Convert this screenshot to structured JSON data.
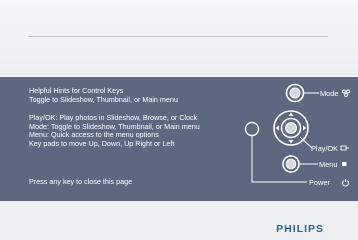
{
  "hints": {
    "block1": [
      "Helpful Hints for Control Keys",
      "Toggle to Slideshow, Thumbnail, or Main menu"
    ],
    "block2": [
      "Play/OK: Play photos in Slideshow, Browse, or Clock",
      "Mode: Toggle to Slideshow, Thumbnail, or Main menu",
      "Menu: Quick access to the menu options",
      "Key pads to move Up, Down, Up Right or Left"
    ],
    "footer": "Press any key to close this page"
  },
  "keys": {
    "mode": "Mode",
    "play_ok": "Play/OK",
    "menu": "Menu",
    "power": "Power"
  },
  "brand": "PHILIPS",
  "icons": [
    "mode-icon",
    "play-ok-icon",
    "menu-icon",
    "power-icon",
    "dpad-arrows-icon"
  ],
  "colors": {
    "panel": "#5d6880",
    "text": "#ffffff",
    "brand": "#2a5fb3"
  }
}
